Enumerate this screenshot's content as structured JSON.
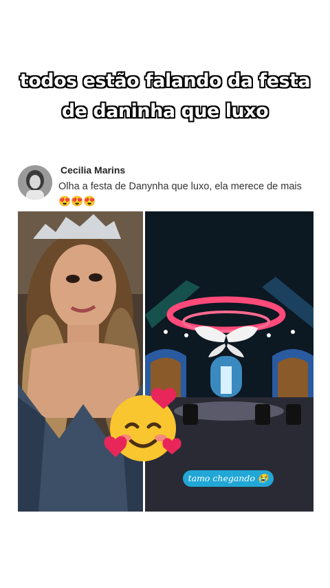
{
  "caption": {
    "line1": "todos estão falando da festa",
    "line2": "de daninha que luxo"
  },
  "post": {
    "author": "Cecilia Marins",
    "text": "Olha a festa de Danynha que luxo, ela merece de mais 😍😍😍"
  },
  "video_overlay": {
    "label": "tamo chegando 😭"
  },
  "icons": {
    "sticker": "smiling-face-with-hearts-icon"
  },
  "colors": {
    "pill_bg": "#21a7d6",
    "caption_text": "#ffffff",
    "caption_stroke": "#000000"
  }
}
